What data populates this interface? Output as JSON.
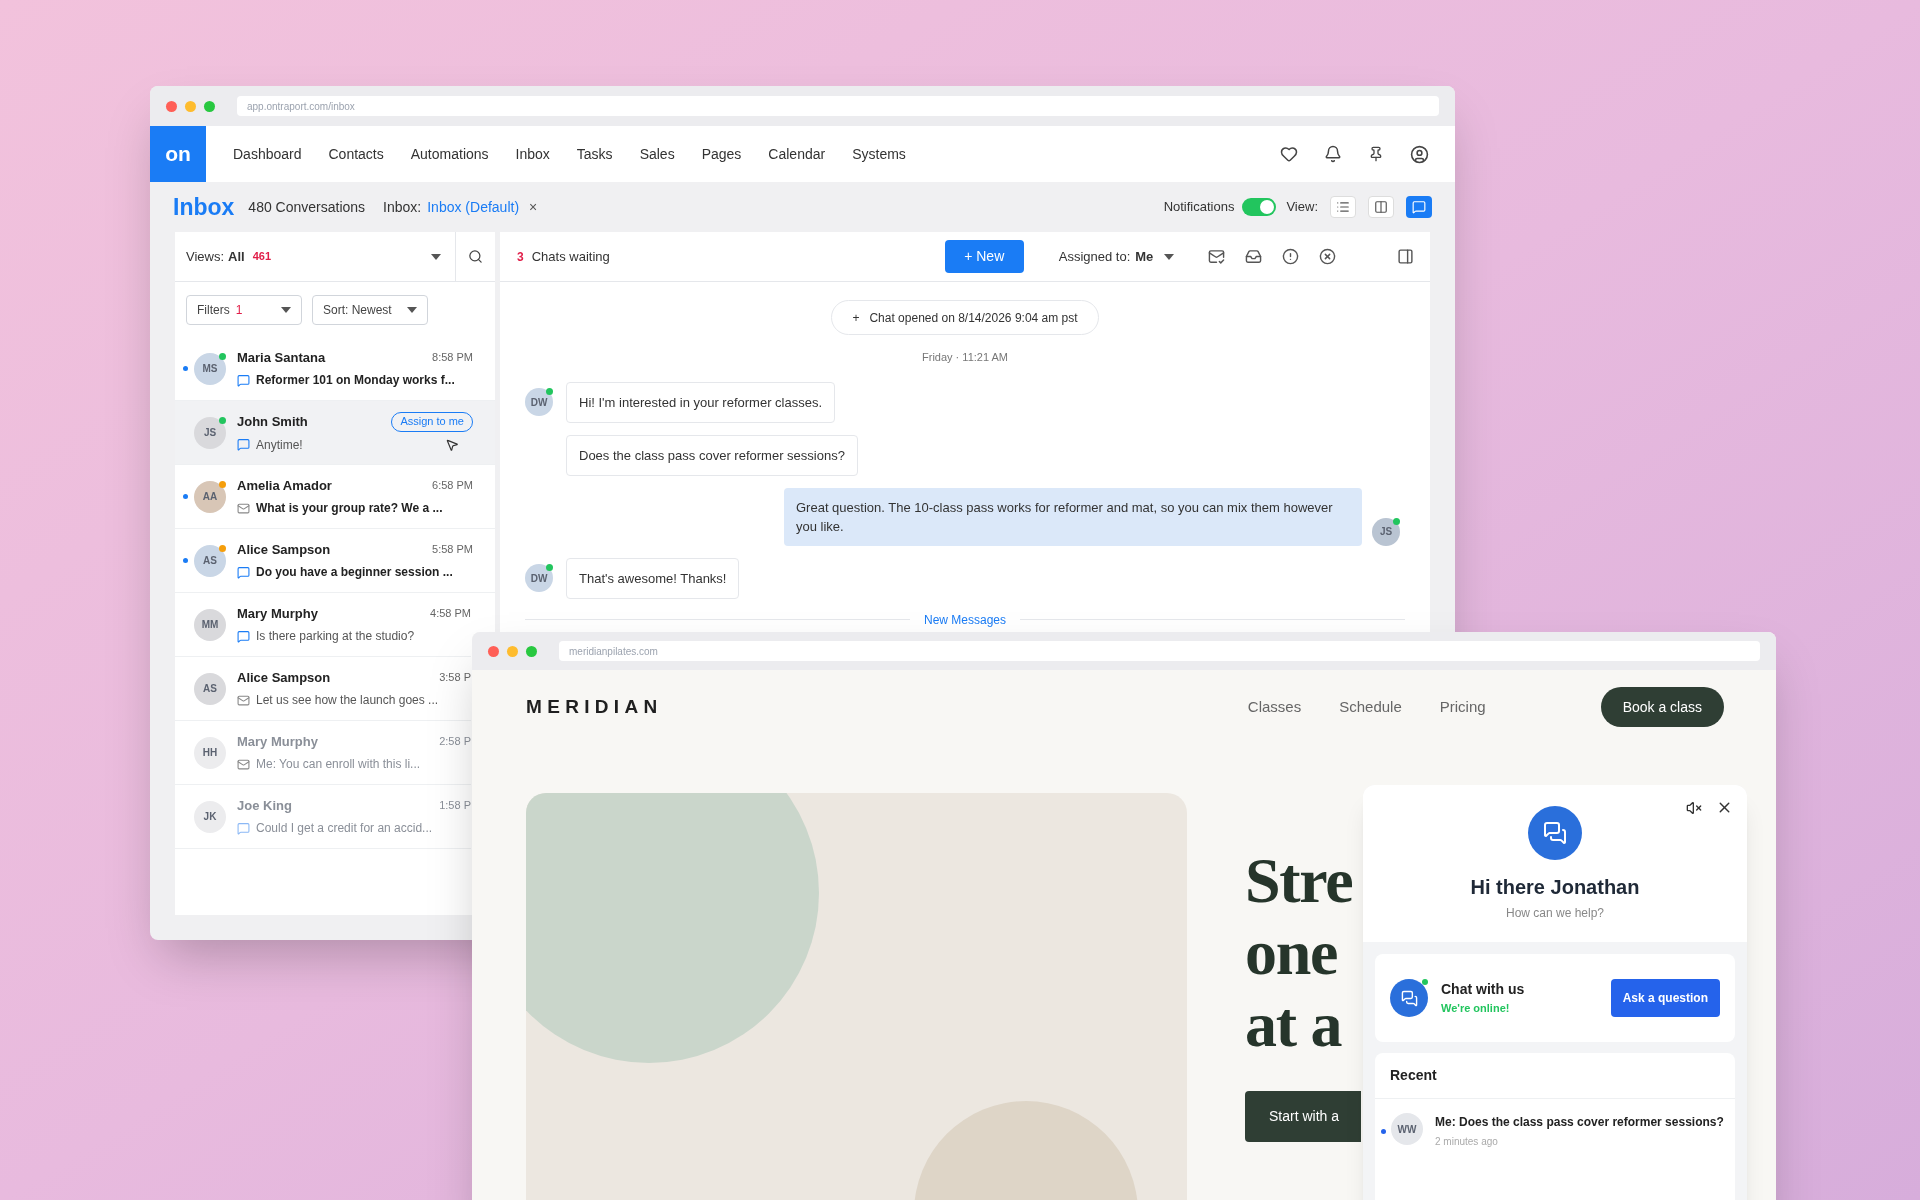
{
  "inbox_window": {
    "url": "app.ontraport.com/inbox",
    "logo": "on",
    "nav": [
      "Dashboard",
      "Contacts",
      "Automations",
      "Inbox",
      "Tasks",
      "Sales",
      "Pages",
      "Calendar",
      "Systems"
    ],
    "page_title": "Inbox",
    "conversation_count": "480 Conversations",
    "inbox_filter": {
      "label": "Inbox:",
      "value": "Inbox (Default)",
      "clear": "×"
    },
    "notifications": {
      "label": "Notifications",
      "on": true
    },
    "view": {
      "label": "View:",
      "options": [
        {
          "kind": "list",
          "selected": false
        },
        {
          "kind": "split",
          "selected": false
        },
        {
          "kind": "chat",
          "selected": true
        }
      ]
    },
    "list": {
      "views": {
        "label": "Views:",
        "value": "All",
        "count": "461"
      },
      "filters": {
        "label": "Filters",
        "count": "1"
      },
      "sort": "Sort: Newest",
      "conversations": [
        {
          "name": "Maria Santana",
          "avatar": {
            "initials": "MS",
            "color": "#c9d6e6"
          },
          "presence": {
            "color": "#22c55e"
          },
          "time": "8:58 PM",
          "preview": "Reformer 101 on Monday works f...",
          "kind": "chat",
          "unread": true,
          "selected": false,
          "dimmed": false
        },
        {
          "name": "John Smith",
          "avatar": {
            "initials": "JS",
            "color": "#d9d9dc"
          },
          "presence": {
            "color": "#22c55e"
          },
          "action": "Assign to me",
          "preview": "Anytime!",
          "kind": "chat",
          "unread": false,
          "selected": true,
          "dimmed": false
        },
        {
          "name": "Amelia Amador",
          "avatar": {
            "initials": "AA",
            "color": "#d8c6b6"
          },
          "presence": {
            "color": "#f59e0b"
          },
          "time": "6:58 PM",
          "preview": "What is your group rate? We a ...",
          "kind": "email",
          "unread": true,
          "selected": false,
          "dimmed": false
        },
        {
          "name": "Alice Sampson",
          "avatar": {
            "initials": "AS",
            "color": "#c9d6e6"
          },
          "presence": {
            "color": "#f59e0b"
          },
          "time": "5:58 PM",
          "preview": "Do you have a beginner session ...",
          "kind": "chat",
          "unread": true,
          "selected": false,
          "dimmed": false
        },
        {
          "name": "Mary Murphy",
          "avatar": {
            "initials": "MM",
            "color": "#d9d9dc"
          },
          "time": "4:58 PM",
          "preview": "Is there parking at the studio?",
          "kind": "chat",
          "unread": false,
          "selected": false,
          "dimmed": false
        },
        {
          "name": "Alice Sampson",
          "avatar": {
            "initials": "AS",
            "color": "#d9d9dc"
          },
          "time": "3:58 P",
          "preview": "Let us see how the launch goes ...",
          "kind": "email",
          "unread": false,
          "selected": false,
          "dimmed": false
        },
        {
          "name": "Mary Murphy",
          "avatar": {
            "initials": "HH",
            "color": "#ececee"
          },
          "time": "2:58 P",
          "preview": "Me: You can enroll with this li...",
          "kind": "email",
          "unread": false,
          "selected": false,
          "dimmed": true
        },
        {
          "name": "Joe King",
          "avatar": {
            "initials": "JK",
            "color": "#ececee"
          },
          "time": "1:58 P",
          "preview": "Could I get a credit for an accid...",
          "kind": "chat",
          "unread": false,
          "selected": false,
          "dimmed": true
        }
      ]
    },
    "chat": {
      "waiting_count": "3",
      "waiting_label": "Chats waiting",
      "new_button": "+ New",
      "assigned": {
        "label": "Assigned to:",
        "value": "Me"
      },
      "opened": {
        "icon": "+",
        "text": "Chat opened on 8/14/2026 9:04 am pst"
      },
      "day_stamp": "Friday · 11:21 AM",
      "messages": [
        {
          "kind": "in",
          "initials": "DW",
          "online": true,
          "text": "Hi! I'm interested in your reformer classes."
        },
        {
          "kind": "in",
          "text": "Does the class pass cover reformer sessions?"
        },
        {
          "kind": "out",
          "initials": "JS",
          "online": true,
          "text": "Great question. The 10-class pass works for reformer and mat, so you can mix them however you like."
        },
        {
          "kind": "in",
          "initials": "DW",
          "online": true,
          "text": "That's awesome! Thanks!"
        }
      ],
      "divider": "New Messages"
    }
  },
  "site_window": {
    "url": "meridianpilates.com",
    "brand": "MERIDIAN",
    "nav": [
      "Classes",
      "Schedule",
      "Pricing"
    ],
    "cta": "Book a class",
    "hero": {
      "heading_lines": [
        "Stre",
        "one",
        "at a"
      ],
      "button": "Start with a"
    },
    "chat_widget": {
      "greeting": "Hi there Jonathan",
      "subtitle": "How can we help?",
      "chat_card": {
        "title": "Chat with us",
        "status": "We're online!",
        "button": "Ask a question"
      },
      "recent": {
        "title": "Recent",
        "items": [
          {
            "initials": "WW",
            "unread": true,
            "text": "Me: Does the class pass cover reformer sessions?",
            "time": "2 minutes ago"
          }
        ]
      }
    }
  }
}
